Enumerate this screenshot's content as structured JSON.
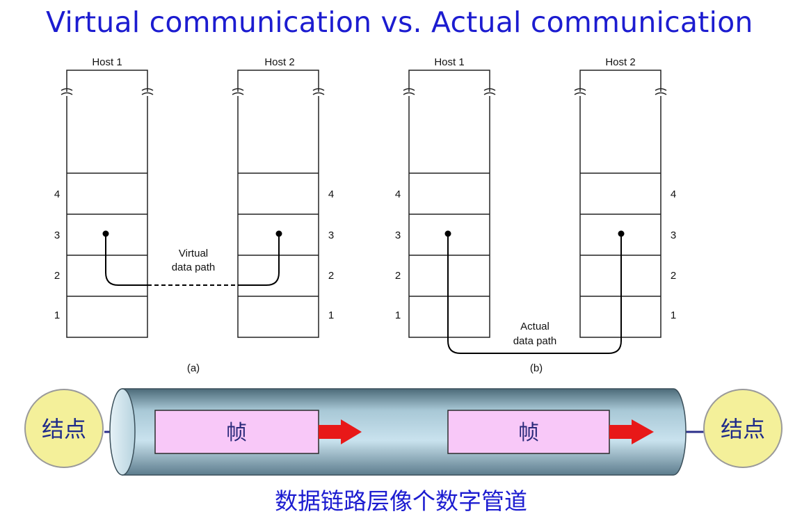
{
  "title": "Virtual communication vs.  Actual communication",
  "diagram_a": {
    "host1": "Host 1",
    "host2": "Host 2",
    "layers": [
      "4",
      "3",
      "2",
      "1"
    ],
    "path_label_line1": "Virtual",
    "path_label_line2": "data path",
    "caption": "(a)"
  },
  "diagram_b": {
    "host1": "Host 1",
    "host2": "Host 2",
    "layers": [
      "4",
      "3",
      "2",
      "1"
    ],
    "path_label_line1": "Actual",
    "path_label_line2": "data path",
    "caption": "(b)"
  },
  "pipe": {
    "left_node": "结点",
    "right_node": "结点",
    "frame1": "帧",
    "frame2": "帧",
    "colors": {
      "node_fill": "#f4f09a",
      "frame_fill": "#f8c8f8",
      "arrow": "#e81818",
      "pipe_body": "#8fb6c9"
    }
  },
  "footer": "数据链路层像个数字管道"
}
